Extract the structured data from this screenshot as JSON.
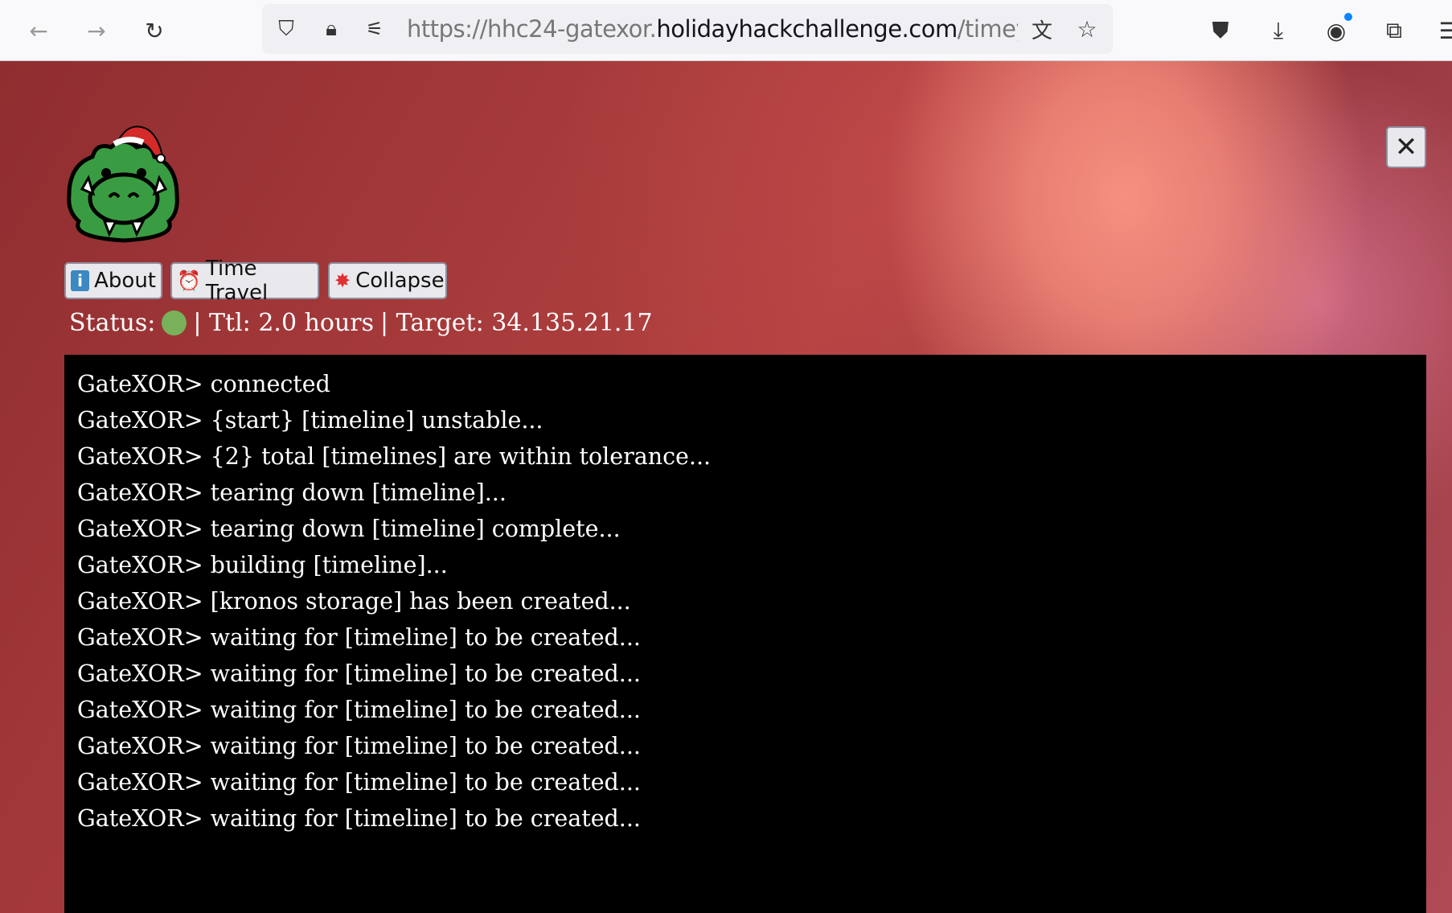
{
  "browser": {
    "url_prefix": "https://hhc24-gatexor.",
    "url_domain": "holidayhackchallenge.com",
    "url_suffix": "/timey",
    "icons": [
      "back-icon",
      "forward-icon",
      "reload-icon",
      "shield-icon",
      "lock-icon",
      "permissions-icon",
      "translate-icon",
      "bookmark-star-icon",
      "pocket-icon",
      "download-icon",
      "account-icon",
      "extensions-icon",
      "menu-icon"
    ]
  },
  "app": {
    "buttons": {
      "about": "About",
      "time_travel": "Time Travel",
      "collapse": "Collapse"
    },
    "status": {
      "label": "Status:",
      "status_color": "#78b159",
      "ttl": "| Ttl: 2.0 hours",
      "target": "| Target: 34.135.21.17"
    },
    "terminal": [
      "GateXOR> connected",
      "GateXOR> {start} [timeline] unstable...",
      "GateXOR> {2} total [timelines] are within tolerance...",
      "GateXOR> tearing down [timeline]...",
      "GateXOR> tearing down [timeline] complete...",
      "GateXOR> building [timeline]...",
      "GateXOR> [kronos storage] has been created...",
      "GateXOR> waiting for [timeline] to be created...",
      "GateXOR> waiting for [timeline] to be created...",
      "GateXOR> waiting for [timeline] to be created...",
      "GateXOR> waiting for [timeline] to be created...",
      "GateXOR> waiting for [timeline] to be created...",
      "GateXOR> waiting for [timeline] to be created..."
    ]
  }
}
